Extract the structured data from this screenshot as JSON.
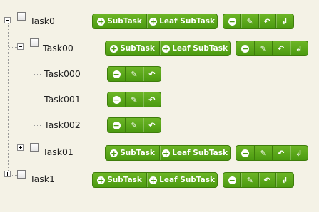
{
  "tree": {
    "nodes": [
      {
        "label": "Task0",
        "expander": "minus"
      },
      {
        "label": "Task00",
        "expander": "minus"
      },
      {
        "label": "Task000",
        "expander": ""
      },
      {
        "label": "Task001",
        "expander": ""
      },
      {
        "label": "Task002",
        "expander": ""
      },
      {
        "label": "Task01",
        "expander": "plus"
      },
      {
        "label": "Task1",
        "expander": "plus"
      }
    ]
  },
  "buttons": {
    "subtask_label": "SubTask",
    "leaf_subtask_label": "Leaf SubTask",
    "icons": {
      "subtask": "plus-circle-icon",
      "leaf_subtask": "plus-circle-icon",
      "delete": "minus-circle-icon",
      "edit": "pencil-icon",
      "move_up": "arrow-return-up-icon",
      "move_back": "arrow-return-left-icon"
    }
  },
  "colors": {
    "background": "#f4f2e6",
    "button_green": "#5aaa1a",
    "button_border": "#3e7d0b"
  }
}
